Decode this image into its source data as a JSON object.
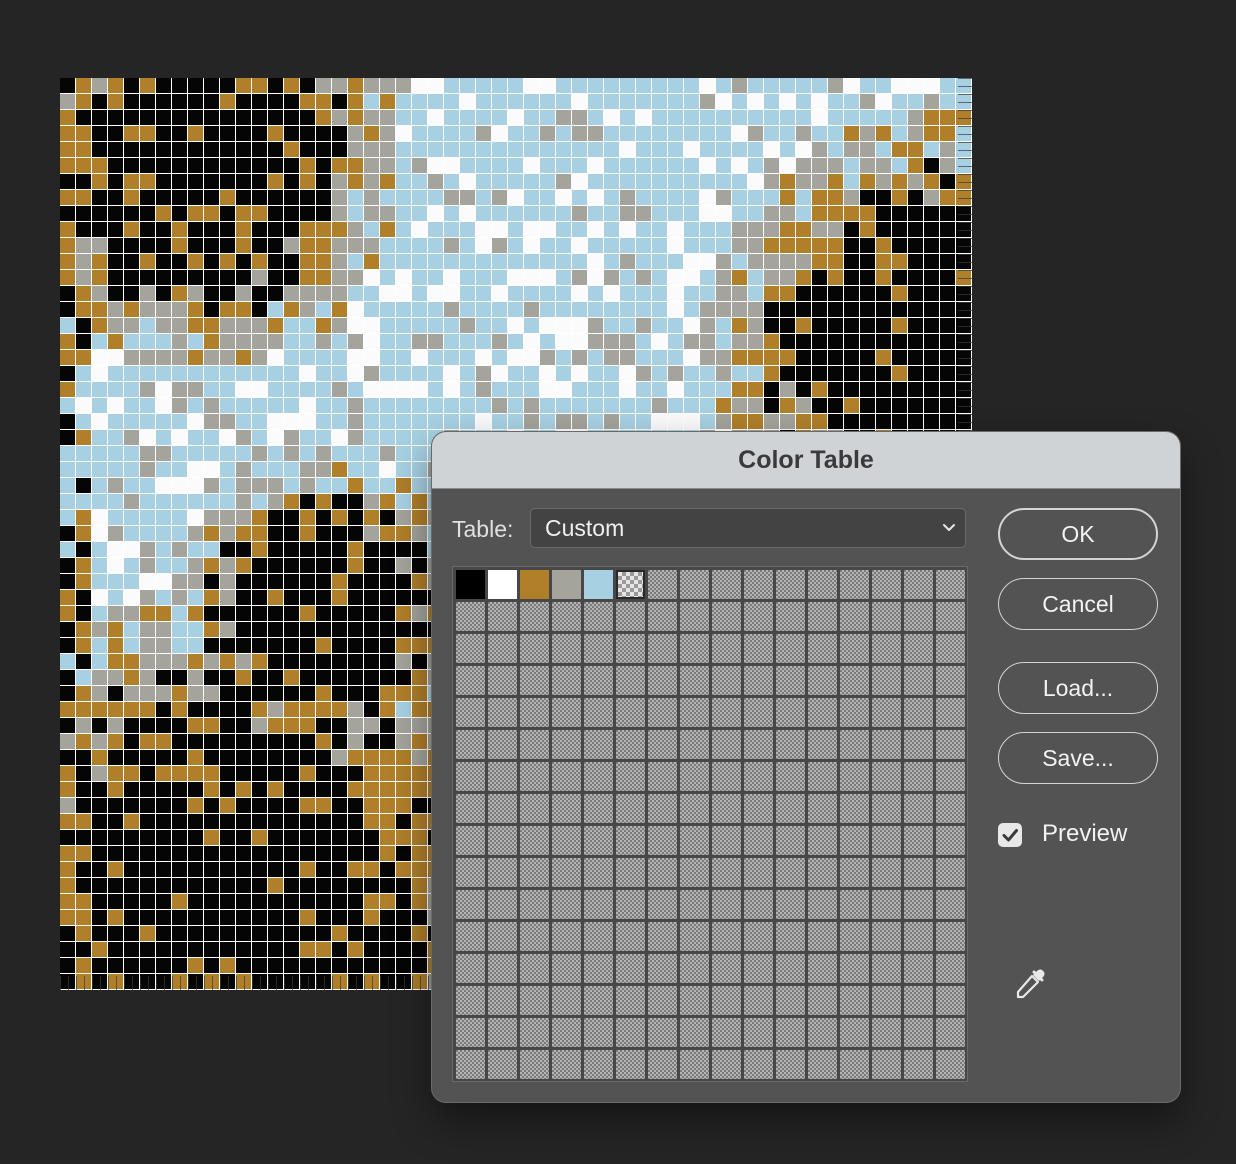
{
  "dialog": {
    "title": "Color Table",
    "table_label": "Table:",
    "table_value": "Custom",
    "buttons": {
      "ok": "OK",
      "cancel": "Cancel",
      "load": "Load...",
      "save": "Save..."
    },
    "preview_label": "Preview",
    "preview_checked": true,
    "swatch_grid": {
      "columns": 16,
      "rows": 16
    },
    "colors": [
      {
        "name": "black",
        "hex": "#000000"
      },
      {
        "name": "white",
        "hex": "#ffffff"
      },
      {
        "name": "ochre",
        "hex": "#b07f29"
      },
      {
        "name": "gray",
        "hex": "#a4a49c"
      },
      {
        "name": "light-blue",
        "hex": "#a7d1e3"
      },
      {
        "name": "transparent",
        "hex": "transparent"
      }
    ],
    "icons": {
      "eyedropper": "eyedropper-icon",
      "chevron": "chevron-down-icon",
      "check": "check-icon"
    }
  },
  "canvas": {
    "grid": 57,
    "palette": {
      "K": "#050505",
      "W": "#fbfbfb",
      "O": "#b07f29",
      "G": "#a4a49c",
      "B": "#a7d1e3"
    }
  }
}
